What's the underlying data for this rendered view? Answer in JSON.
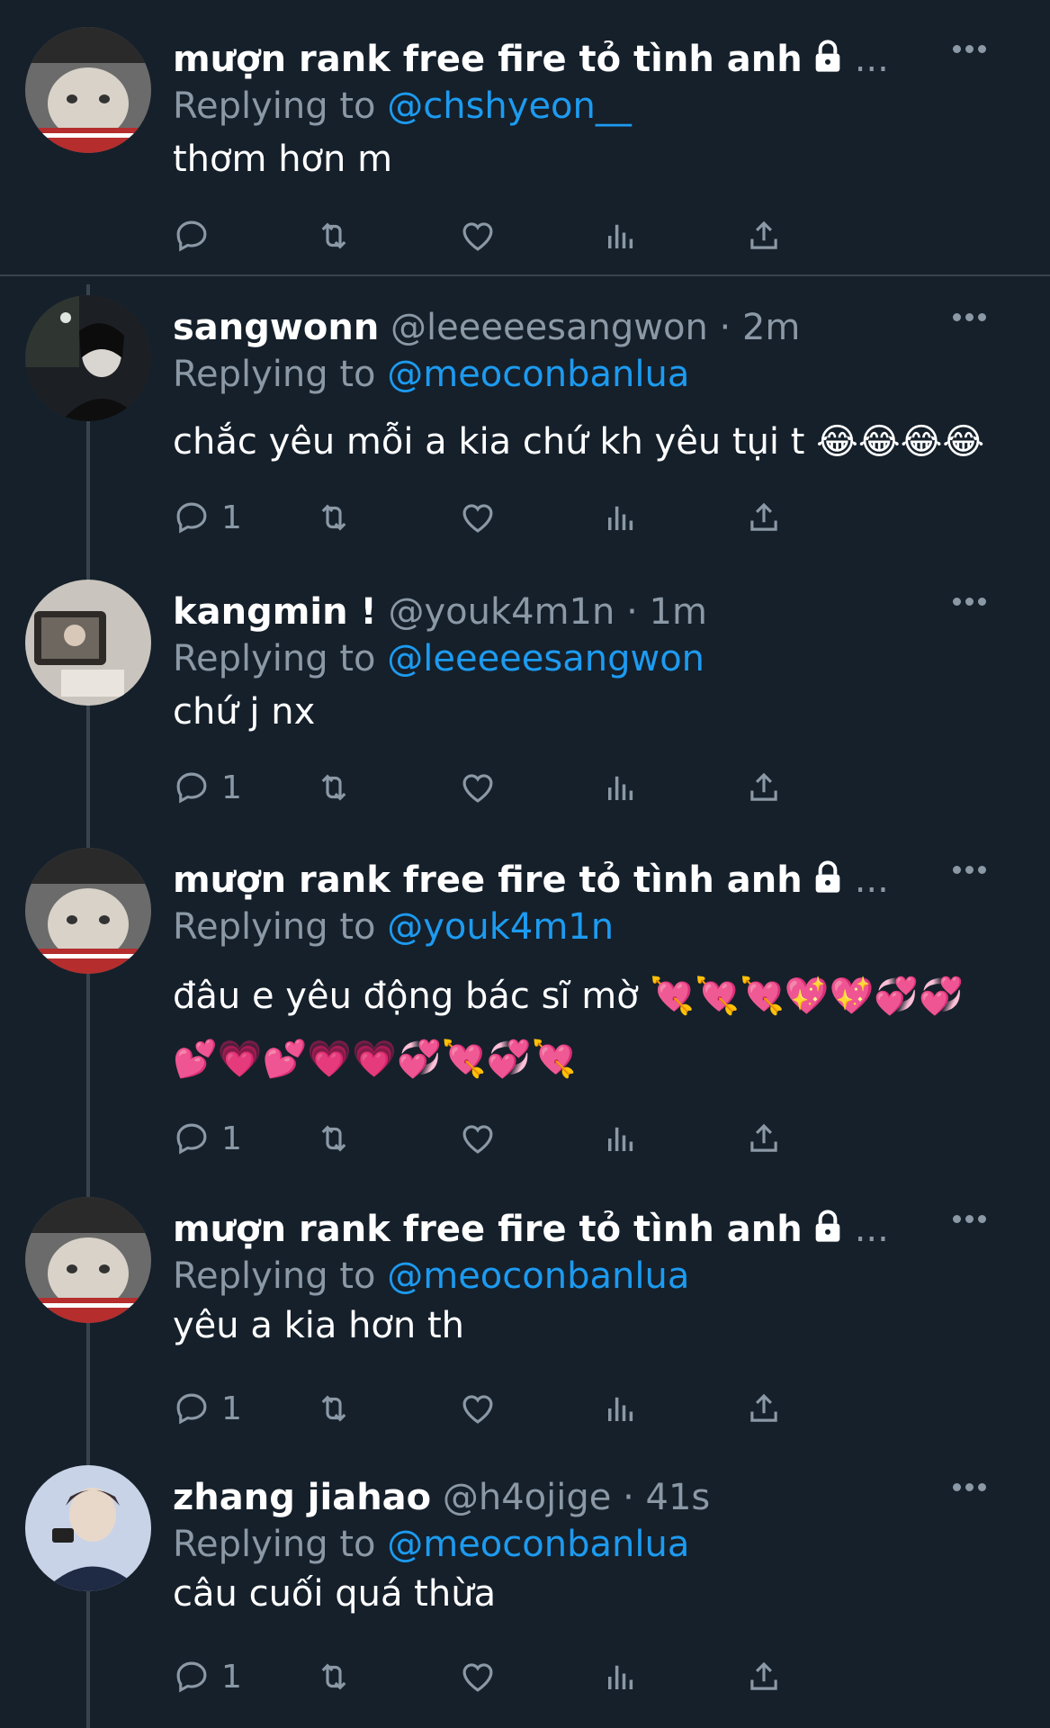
{
  "colors": {
    "background": "#15202b",
    "text": "#ffffff",
    "muted": "#8b98a5",
    "link": "#1d9bf0",
    "divider": "#38444d"
  },
  "tweets": [
    {
      "name": "mượn rank free fire tỏ tình anh",
      "handle": "",
      "time": "",
      "truncated": "...",
      "locked": true,
      "replying_label": "Replying to",
      "replying_to": "@chshyeon__",
      "text": "thơm hơn m",
      "text2": "",
      "reply_count": "",
      "avatar": "cat-avatar"
    },
    {
      "name": "sangwonn",
      "handle": "@leeeeesangwon",
      "time": "· 2m",
      "truncated": "",
      "locked": false,
      "replying_label": "Replying to",
      "replying_to": "@meoconbanlua",
      "text": "chắc yêu mỗi a kia chứ kh yêu tụi t 😂😂😂😂",
      "text2": "",
      "reply_count": "1",
      "avatar": "dark-portrait-avatar"
    },
    {
      "name": "kangmin !",
      "handle": "@youk4m1n",
      "time": "· 1m",
      "truncated": "",
      "locked": false,
      "replying_label": "Replying to",
      "replying_to": "@leeeeesangwon",
      "text": "chứ j nx",
      "text2": "",
      "reply_count": "1",
      "avatar": "mirror-selfie-avatar"
    },
    {
      "name": "mượn rank free fire tỏ tình anh",
      "handle": "",
      "time": "",
      "truncated": "...",
      "locked": true,
      "replying_label": "Replying to",
      "replying_to": "@youk4m1n",
      "text": "đâu e yêu động bác sĩ mờ 💘💘💘💖💖💞💞",
      "text2": "💕💗💕💗💗💞💘💞💘",
      "reply_count": "1",
      "avatar": "cat-avatar"
    },
    {
      "name": "mượn rank free fire tỏ tình anh",
      "handle": "",
      "time": "",
      "truncated": "...",
      "locked": true,
      "replying_label": "Replying to",
      "replying_to": "@meoconbanlua",
      "text": "yêu a kia hơn th",
      "text2": "",
      "reply_count": "1",
      "avatar": "cat-avatar"
    },
    {
      "name": "zhang jiahao",
      "handle": "@h4ojige",
      "time": "· 41s",
      "truncated": "",
      "locked": false,
      "replying_label": "Replying to",
      "replying_to": "@meoconbanlua",
      "text": "câu cuối quá thừa",
      "text2": "",
      "reply_count": "1",
      "avatar": "idol-photo-avatar"
    }
  ]
}
